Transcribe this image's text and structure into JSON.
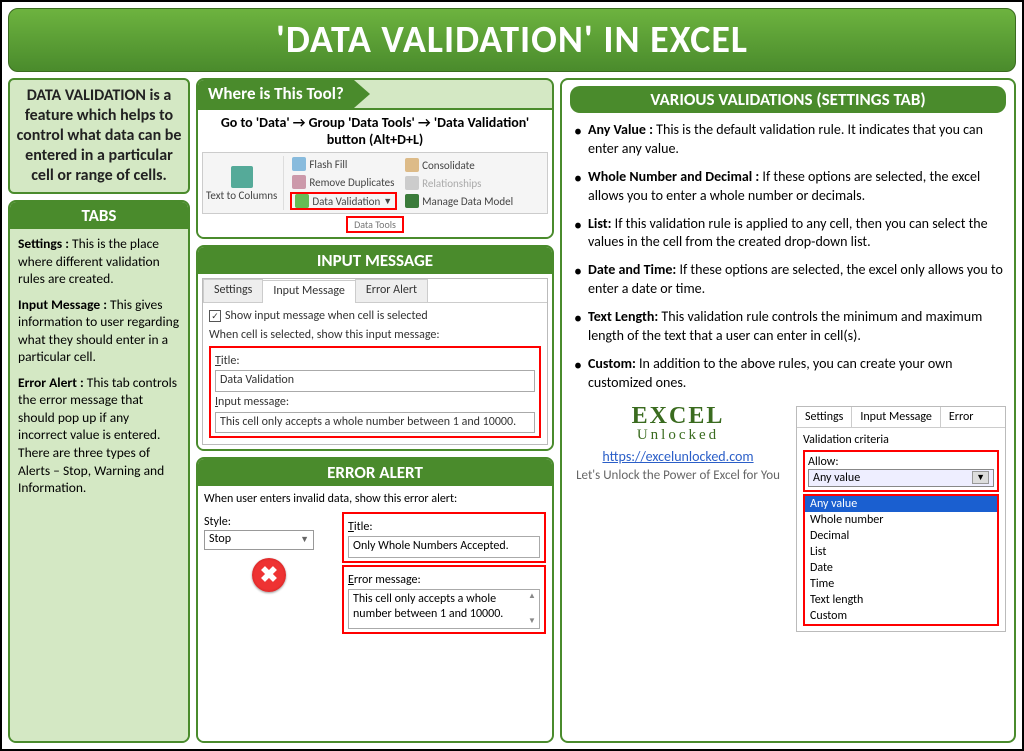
{
  "title": "'DATA VALIDATION' IN EXCEL",
  "description": "DATA VALIDATION is a feature which helps to control what data can be entered in a particular cell or range of cells.",
  "tabs_header": "TABS",
  "tabs": {
    "settings_b": "Settings :",
    "settings_t": " This is the place where different validation rules are created.",
    "input_b": "Input Message :",
    "input_t": " This gives information to user regarding what they should enter in a particular cell.",
    "error_b": "Error Alert :",
    "error_t": " This tab controls the error message that should pop up if any incorrect value is entered. There are three types of Alerts – Stop, Warning and Information."
  },
  "where_header": "Where is This Tool?",
  "where_instr": "Go to 'Data' → Group 'Data Tools' → 'Data Validation' button (Alt+D+L)",
  "ribbon": {
    "text_to_columns": "Text to Columns",
    "flash_fill": "Flash Fill",
    "remove_dup": "Remove Duplicates",
    "data_validation": "Data Validation",
    "consolidate": "Consolidate",
    "relationships": "Relationships",
    "manage_model": "Manage Data Model",
    "group": "Data Tools"
  },
  "input_message": {
    "header": "INPUT MESSAGE",
    "tab_settings": "Settings",
    "tab_input": "Input Message",
    "tab_error": "Error Alert",
    "chk": "Show input message when cell is selected",
    "when": "When cell is selected, show this input message:",
    "title_lbl": "Title:",
    "title_val": "Data Validation",
    "msg_lbl": "Input message:",
    "msg_val": "This cell only accepts a whole number between 1 and 10000."
  },
  "error_alert": {
    "header": "ERROR ALERT",
    "when": "When user enters invalid data, show this error alert:",
    "style_lbl": "Style:",
    "style_val": "Stop",
    "title_lbl": "Title:",
    "title_val": "Only Whole Numbers Accepted.",
    "msg_lbl": "Error message:",
    "msg_val": "This cell only accepts a whole number between 1 and 10000."
  },
  "validations": {
    "header": "VARIOUS VALIDATIONS (SETTINGS TAB)",
    "items": [
      {
        "b": "Any Value :",
        "t": "  This is the default validation rule. It indicates that you can enter any value."
      },
      {
        "b": "Whole Number and Decimal :",
        "t": " If these options are selected, the excel allows you to enter a whole number or decimals."
      },
      {
        "b": "List:",
        "t": " If this validation rule is applied to any cell, then you can select the values in the cell from the created drop-down list."
      },
      {
        "b": "Date and Time:",
        "t": " If these options are selected, the excel only allows you to enter a date or time."
      },
      {
        "b": "Text Length:",
        "t": " This validation rule controls the minimum and maximum length of the text that a user can enter in cell(s)."
      },
      {
        "b": "Custom:",
        "t": " In addition to the above rules, you can create your own customized ones."
      }
    ]
  },
  "brand": {
    "name1": "EXCEL",
    "name2": "Unlocked",
    "url": "https://excelunlocked.com",
    "tag": "Let's Unlock the Power of Excel for You"
  },
  "settings_dlg": {
    "tab_settings": "Settings",
    "tab_input": "Input Message",
    "tab_error": "Error",
    "criteria": "Validation criteria",
    "allow_lbl": "Allow:",
    "allow_val": "Any value",
    "options": [
      "Any value",
      "Whole number",
      "Decimal",
      "List",
      "Date",
      "Time",
      "Text length",
      "Custom"
    ]
  }
}
